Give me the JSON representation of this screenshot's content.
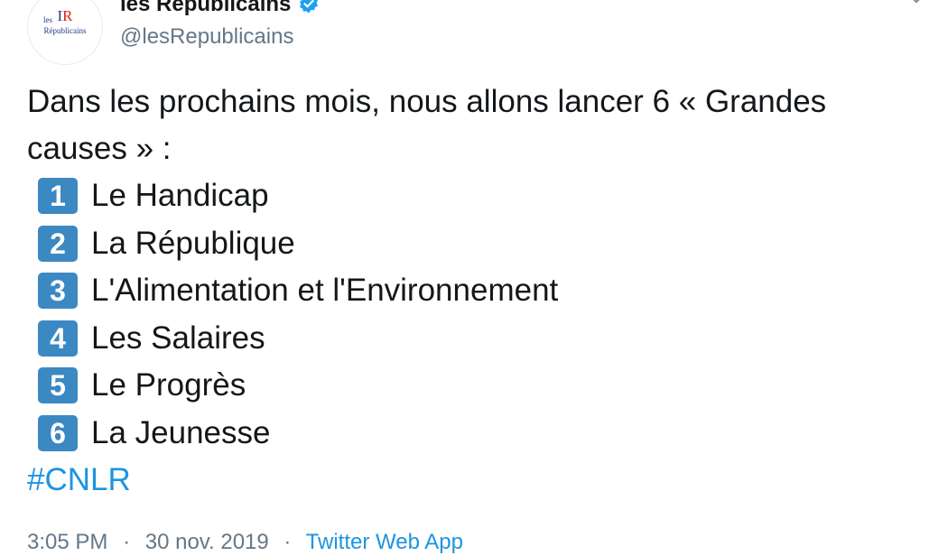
{
  "author": {
    "display_name": "les Républicains",
    "handle": "@lesRepublicains",
    "avatar_mark_blue": "I",
    "avatar_mark_red": "R",
    "avatar_small": "les",
    "avatar_word": "Républicains",
    "verified_icon": "verified-badge-icon"
  },
  "tweet": {
    "intro": "Dans les prochains mois, nous allons lancer 6 « Grandes causes » :",
    "causes": [
      {
        "number": "1",
        "label": "Le Handicap"
      },
      {
        "number": "2",
        "label": "La République"
      },
      {
        "number": "3",
        "label": "L'Alimentation et l'Environnement"
      },
      {
        "number": "4",
        "label": "Les Salaires"
      },
      {
        "number": "5",
        "label": "Le Progrès"
      },
      {
        "number": "6",
        "label": "La Jeunesse"
      }
    ],
    "hashtag": "#CNLR"
  },
  "footer": {
    "time": "3:05 PM",
    "separator": "·",
    "date": "30 nov. 2019",
    "source": "Twitter Web App"
  },
  "colors": {
    "text": "#14171a",
    "secondary": "#657786",
    "link": "#1b95e0",
    "verified": "#1da1f2",
    "keycap": "#3b88c3"
  }
}
